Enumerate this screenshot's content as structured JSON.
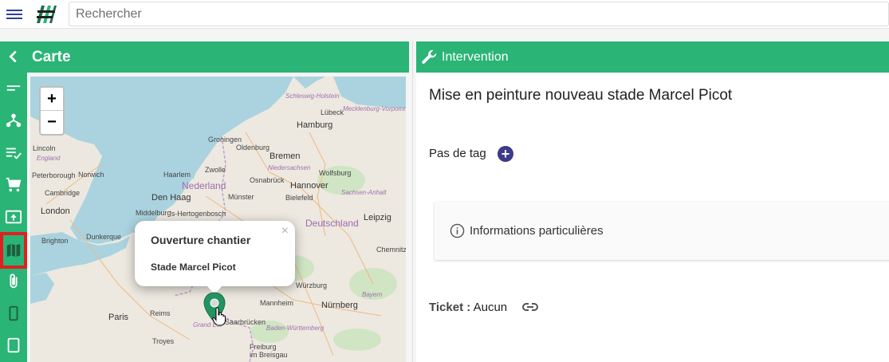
{
  "topbar": {
    "search_placeholder": "Rechercher"
  },
  "sidebar": {
    "items": [
      {
        "icon": "chevron-left-icon"
      },
      {
        "icon": "short-text-icon"
      },
      {
        "icon": "hierarchy-icon"
      },
      {
        "icon": "playlist-check-icon"
      },
      {
        "icon": "cart-icon"
      },
      {
        "icon": "upload-box-icon"
      },
      {
        "icon": "map-icon",
        "active": true
      },
      {
        "icon": "paperclip-icon"
      },
      {
        "icon": "phone-icon"
      },
      {
        "icon": "tablet-icon"
      }
    ]
  },
  "carte": {
    "title": "Carte",
    "zoom_in": "+",
    "zoom_out": "−",
    "popup": {
      "title": "Ouverture chantier",
      "subtitle": "Stade Marcel Picot",
      "close": "×"
    },
    "labels": {
      "lincoln": "Lincoln",
      "england": "England",
      "peterborough": "Peterborough",
      "norwich": "Norwich",
      "cambridge": "Cambridge",
      "london": "London",
      "brighton": "Brighton",
      "dunkerque": "Dunkerque",
      "groningen": "Groningen",
      "oldenburg": "Oldenburg",
      "bremen": "Bremen",
      "hamburg": "Hamburg",
      "lubeck": "Lübeck",
      "haarlem": "Haarlem",
      "zwolle": "Zwolle",
      "nederland": "Nederland",
      "osnabruck": "Osnabrück",
      "hannover": "Hannover",
      "wolfsburg": "Wolfsburg",
      "denhaag": "Den Haag",
      "munster": "Münster",
      "bielefeld": "Bielefeld",
      "middelburg": "Middelburg",
      "hertogenbosch": "'s-Hertogenbosch",
      "deutschland": "Deutschland",
      "leipzig": "Leipzig",
      "chemnitz": "Chemnitz",
      "wurzburg": "Würzburg",
      "nurnberg": "Nürnberg",
      "mannheim": "Mannheim",
      "saarbrucken": "Saarbrücken",
      "paris": "Paris",
      "reims": "Reims",
      "troyes": "Troyes",
      "freiburg": "Freiburg\nim Breisgau",
      "schleswig": "Schleswig-Holstein",
      "mecklenburg": "Mecklenburg-Vorpommern",
      "niedersachsen": "Niedersachsen",
      "sachsen_anhalt": "Sachsen-Anhalt",
      "bayern": "Bayern",
      "baden": "Baden-Württemberg",
      "grand_est": "Grand Est"
    }
  },
  "intervention": {
    "header": "Intervention",
    "title": "Mise en peinture nouveau stade Marcel Picot",
    "tag_label": "Pas de tag",
    "tag_add": "+",
    "info_label": "Informations particulières",
    "ticket_label": "Ticket :",
    "ticket_value": "Aucun"
  },
  "colors": {
    "accent": "#2ab476",
    "tag_button": "#3d3a8c",
    "active_outline": "#e02020"
  }
}
